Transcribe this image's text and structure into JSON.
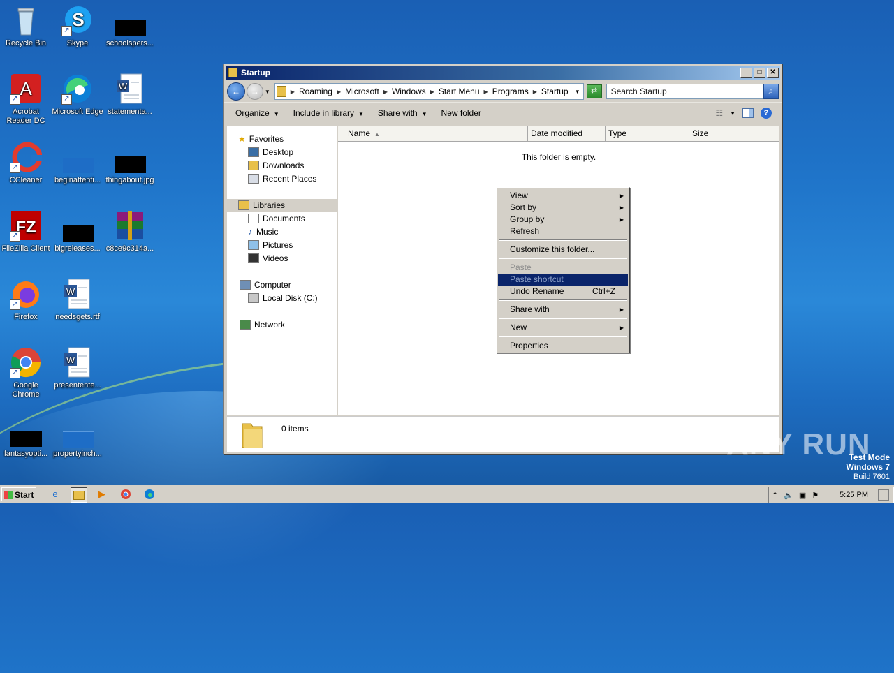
{
  "desktop": {
    "icons": [
      {
        "label": "Recycle Bin"
      },
      {
        "label": "Skype"
      },
      {
        "label": "schoolspers..."
      },
      {
        "label": "Acrobat Reader DC"
      },
      {
        "label": "Microsoft Edge"
      },
      {
        "label": "statementa..."
      },
      {
        "label": "CCleaner"
      },
      {
        "label": "beginattenti..."
      },
      {
        "label": "thingabout.jpg"
      },
      {
        "label": "FileZilla Client"
      },
      {
        "label": "bigreleases..."
      },
      {
        "label": "c8ce9c314a..."
      },
      {
        "label": "Firefox"
      },
      {
        "label": "needsgets.rtf"
      },
      {
        "label": "Google Chrome"
      },
      {
        "label": "presentente..."
      },
      {
        "label": "fantasyopti..."
      },
      {
        "label": "propertyinch..."
      }
    ],
    "watermark": "ANY RUN",
    "test_mode": {
      "line1": "Test Mode",
      "line2": "Windows 7",
      "line3": "Build 7601"
    }
  },
  "window": {
    "title": "Startup",
    "controls": {
      "minimize": "_",
      "maximize": "□",
      "close": "✕"
    },
    "breadcrumbs": [
      "Roaming",
      "Microsoft",
      "Windows",
      "Start Menu",
      "Programs",
      "Startup"
    ],
    "search_placeholder": "Search Startup",
    "toolbar": {
      "organize": "Organize",
      "include_in_library": "Include in library",
      "share_with": "Share with",
      "new_folder": "New folder"
    },
    "nav": {
      "favorites": "Favorites",
      "desktop": "Desktop",
      "downloads": "Downloads",
      "recent_places": "Recent Places",
      "libraries": "Libraries",
      "documents": "Documents",
      "music": "Music",
      "pictures": "Pictures",
      "videos": "Videos",
      "computer": "Computer",
      "local_disk": "Local Disk (C:)",
      "network": "Network"
    },
    "columns": [
      "Name",
      "Date modified",
      "Type",
      "Size"
    ],
    "empty_message": "This folder is empty.",
    "status": "0 items"
  },
  "context_menu": {
    "view": "View",
    "sort_by": "Sort by",
    "group_by": "Group by",
    "refresh": "Refresh",
    "customize": "Customize this folder...",
    "paste": "Paste",
    "paste_shortcut": "Paste shortcut",
    "undo_rename": "Undo Rename",
    "undo_shortcut": "Ctrl+Z",
    "share_with": "Share with",
    "new": "New",
    "properties": "Properties"
  },
  "taskbar": {
    "start": "Start",
    "clock": "5:25 PM"
  }
}
